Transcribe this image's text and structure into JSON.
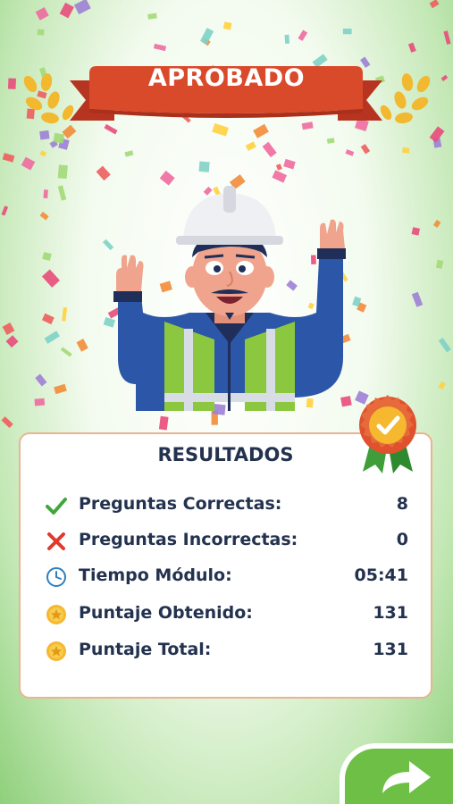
{
  "banner": {
    "title": "APROBADO"
  },
  "results": {
    "title": "RESULTADOS",
    "rows": [
      {
        "label": "Preguntas Correctas:",
        "value": "8",
        "icon": "check-icon"
      },
      {
        "label": "Preguntas Incorrectas:",
        "value": "0",
        "icon": "cross-icon"
      },
      {
        "label": "Tiempo Módulo:",
        "value": "05:41",
        "icon": "clock-icon"
      },
      {
        "label": "Puntaje Obtenido:",
        "value": "131",
        "icon": "star-coin-icon"
      },
      {
        "label": "Puntaje Total:",
        "value": "131",
        "icon": "star-coin-icon"
      }
    ]
  },
  "colors": {
    "banner_red": "#d94a2b",
    "text_navy": "#23324f",
    "card_border": "#e9b58f",
    "accent_green": "#6ebf45",
    "check_green": "#3fa83a",
    "cross_red": "#e2392d",
    "coin_gold": "#f5b82e"
  }
}
